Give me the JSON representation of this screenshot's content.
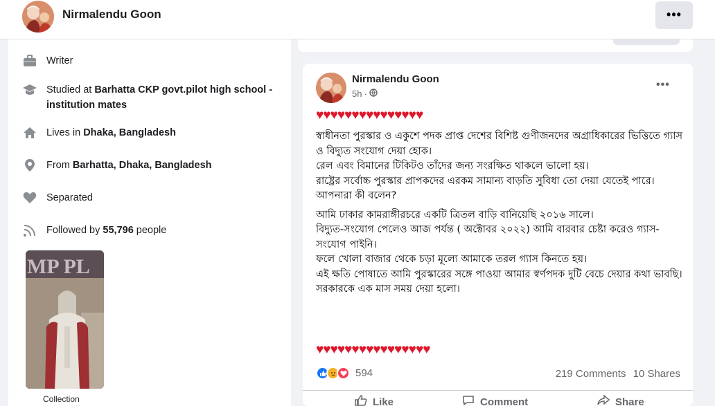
{
  "header": {
    "profile_name": "Nirmalendu Goon",
    "more_label": "•••"
  },
  "intro": {
    "items": [
      {
        "icon": "briefcase-icon",
        "prefix": "Writer",
        "bold": "",
        "suffix": ""
      },
      {
        "icon": "graduation-cap-icon",
        "prefix": "Studied at ",
        "bold": "Barhatta CKP govt.pilot high school -institution mates",
        "suffix": ""
      },
      {
        "icon": "home-icon",
        "prefix": "Lives in ",
        "bold": "Dhaka, Bangladesh",
        "suffix": ""
      },
      {
        "icon": "location-pin-icon",
        "prefix": "From ",
        "bold": "Barhatta, Dhaka, Bangladesh",
        "suffix": ""
      },
      {
        "icon": "heart-icon",
        "prefix": "Separated",
        "bold": "",
        "suffix": ""
      },
      {
        "icon": "rss-icon",
        "prefix": "Followed by ",
        "bold": "55,796",
        "suffix": " people"
      }
    ],
    "photo_caption": "Collection",
    "photo_sign_text": "MP PL"
  },
  "post": {
    "author": "Nirmalendu Goon",
    "time": "5h",
    "privacy_icon": "globe-icon",
    "more_label": "•••",
    "hearts_top": "♥♥♥♥♥♥♥♥♥♥♥♥♥♥♥",
    "hearts_bottom": "♥♥♥♥♥♥♥♥♥♥♥♥♥♥♥♥",
    "paragraphs": [
      "স্বাধীনতা পুরস্কার ও একুশে পদক প্রাপ্ত দেশের বিশিষ্ট গুণীজনদের অগ্রাধিকারের ভিত্তিতে গ্যাস ও বিদ্যুত সংযোগ দেয়া হোক।\nরেল এবং বিমানের টিকিটও তাঁদের জন্য সংরক্ষিত থাকলে ভালো হয়।\nরাষ্ট্রের সর্বোচ্চ পুরস্কার প্রাপকদের এরকম সামান্য বাড়তি সুবিধা তো দেয়া যেতেই পারে।\nআপনারা কী বলেন?",
      "আমি ঢাকার কামরাঙ্গীরচরে একটি ত্রিতল বাড়ি বানিয়েছি ২০১৬ সালে।\nবিদ্যুত-সংযোগ পেলেও আজ পর্যন্ত ( অক্টোবর ২০২২) আমি বারবার চেষ্টা করেও গ্যাস-সংযোগ পাইনি।\nফলে খোলা বাজার থেকে চড়া মূল্যে আমাকে তরল গ্যাস কিনতে হয়।\nএই ক্ষতি পোষাতে আমি পুরস্কারের সঙ্গে পাওয়া আমার স্বর্ণপদক দুটি বেচে দেয়ার কথা ভাবছি।\nসরকারকে এক মাস সময় দেয়া হলো।"
    ],
    "reaction_count": "594",
    "comments": "219 Comments",
    "shares": "10 Shares",
    "actions": [
      "Like",
      "Comment",
      "Share"
    ]
  },
  "colors": {
    "heart_red": "#e0162b",
    "like_blue": "#1877f2",
    "sad_yellow": "#f7b125",
    "love_red": "#f33e58"
  }
}
